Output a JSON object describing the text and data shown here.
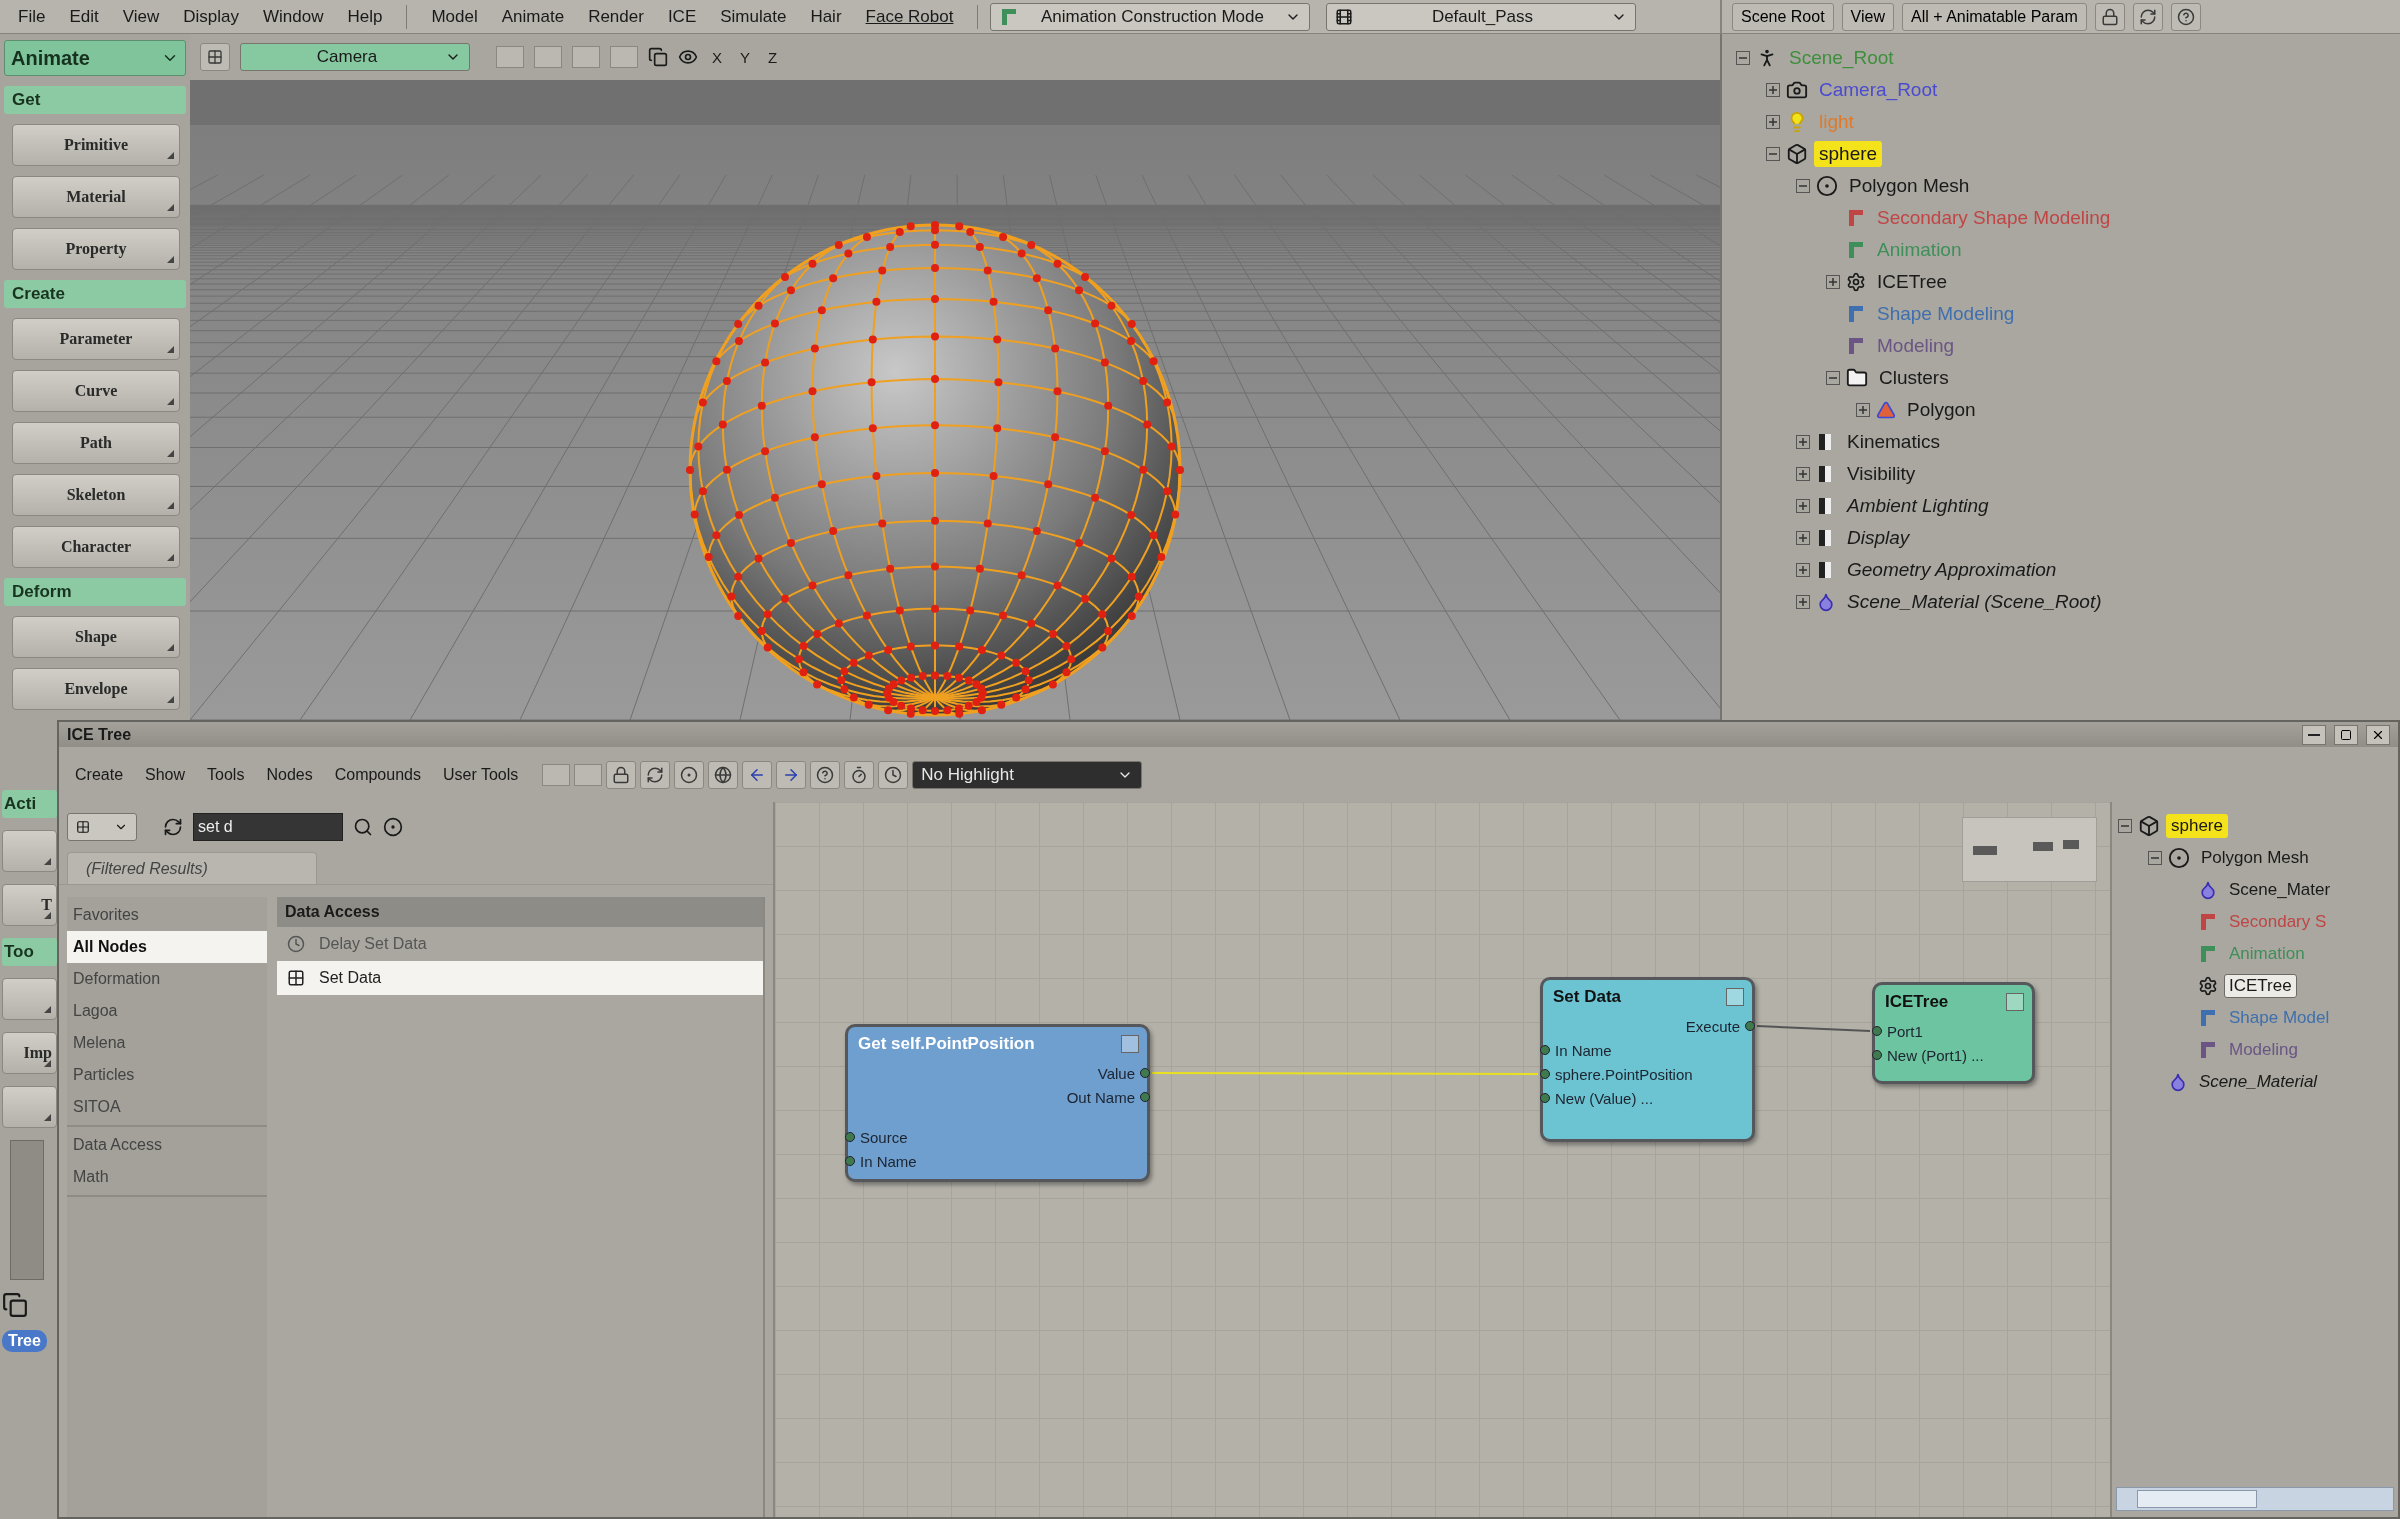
{
  "menu_bar": {
    "menus": [
      {
        "label": "File",
        "kind": "menu"
      },
      {
        "label": "Edit",
        "kind": "menu"
      },
      {
        "label": "View",
        "kind": "menu"
      },
      {
        "label": "Display",
        "kind": "menu"
      },
      {
        "label": "Window",
        "kind": "menu"
      },
      {
        "label": "Help",
        "kind": "menu"
      }
    ],
    "modules": [
      {
        "label": "Model",
        "kind": "menu"
      },
      {
        "label": "Animate",
        "kind": "menu"
      },
      {
        "label": "Render",
        "kind": "menu"
      },
      {
        "label": "ICE",
        "kind": "menu"
      },
      {
        "label": "Simulate",
        "kind": "menu"
      },
      {
        "label": "Hair",
        "kind": "menu"
      },
      {
        "label": "Face Robot",
        "kind": "link"
      }
    ],
    "mode_dropdown": "Animation Construction Mode",
    "pass_dropdown": "Default_Pass"
  },
  "explorer_toolbar": {
    "buttons": [
      "Scene Root",
      "View",
      "All + Animatable Param"
    ]
  },
  "layout_dropdown": "Animate",
  "palette": {
    "sections": [
      {
        "title": "Get",
        "buttons": [
          "Primitive",
          "Material",
          "Property"
        ]
      },
      {
        "title": "Create",
        "buttons": [
          "Parameter",
          "Curve",
          "Path",
          "Skeleton",
          "Character"
        ]
      },
      {
        "title": "Deform",
        "buttons": [
          "Shape",
          "Envelope"
        ]
      }
    ]
  },
  "palette_fragments": [
    {
      "label": "Acti",
      "kind": "header"
    },
    {
      "kind": "button"
    },
    {
      "label": "T",
      "kind": "button"
    },
    {
      "label": "Too",
      "kind": "header"
    },
    {
      "kind": "button"
    },
    {
      "label": "Imp",
      "kind": "button"
    },
    {
      "kind": "button"
    },
    {
      "label": "Tree",
      "kind": "tag"
    }
  ],
  "viewport_toolbar": {
    "camera": "Camera",
    "axes": [
      "X",
      "Y",
      "Z"
    ]
  },
  "scene_tree": [
    {
      "label": "Scene_Root",
      "kind": "null",
      "color": "#3d8f3d",
      "expanded": true,
      "selected": false,
      "children": [
        {
          "label": "Camera_Root",
          "kind": "camera",
          "color": "#4b4bd0",
          "expanded": false,
          "selected": false
        },
        {
          "label": "light",
          "kind": "light",
          "color": "#e07a2a",
          "expanded": false,
          "selected": false
        },
        {
          "label": "sphere",
          "kind": "mesh",
          "expanded": true,
          "selected": true,
          "children": [
            {
              "label": "Polygon Mesh",
              "kind": "geometry",
              "expanded": true,
              "selected": false,
              "children": [
                {
                  "label": "Secondary Shape Modeling",
                  "kind": "operator",
                  "color": "#c04545",
                  "selected": false
                },
                {
                  "label": "Animation",
                  "kind": "operator",
                  "color": "#3f8f5a",
                  "selected": false
                },
                {
                  "label": "ICETree",
                  "kind": "icetree",
                  "expanded": false,
                  "selected": false
                },
                {
                  "label": "Shape Modeling",
                  "kind": "operator",
                  "color": "#3f6fae",
                  "selected": false
                },
                {
                  "label": "Modeling",
                  "kind": "operator",
                  "color": "#6a5585",
                  "selected": false
                },
                {
                  "label": "Clusters",
                  "kind": "cluster",
                  "expanded": true,
                  "selected": false,
                  "children": [
                    {
                      "label": "Polygon",
                      "kind": "polygon",
                      "expanded": false,
                      "selected": false
                    }
                  ]
                }
              ]
            },
            {
              "label": "Kinematics",
              "kind": "property",
              "expanded": false,
              "selected": false
            },
            {
              "label": "Visibility",
              "kind": "property",
              "expanded": false,
              "selected": false
            },
            {
              "label": "Ambient Lighting",
              "kind": "shared",
              "expanded": false,
              "selected": false
            },
            {
              "label": "Display",
              "kind": "shared",
              "expanded": false,
              "selected": false
            },
            {
              "label": "Geometry Approximation",
              "kind": "shared",
              "expanded": false,
              "selected": false
            },
            {
              "label": "Scene_Material (Scene_Root)",
              "kind": "material",
              "expanded": false,
              "selected": false
            }
          ]
        }
      ]
    }
  ],
  "ice_window": {
    "title": "ICE Tree",
    "menus": [
      "Create",
      "Show",
      "Tools",
      "Nodes",
      "Compounds",
      "User Tools"
    ],
    "highlight_dropdown": "No Highlight",
    "search": {
      "value": "set d"
    },
    "filter_tab": "(Filtered Results)",
    "category_groups": [
      {
        "items": [
          {
            "label": "Favorites",
            "selected": false
          },
          {
            "label": "All Nodes",
            "selected": true
          },
          {
            "label": "Deformation",
            "selected": false
          },
          {
            "label": "Lagoa",
            "selected": false
          },
          {
            "label": "Melena",
            "selected": false
          },
          {
            "label": "Particles",
            "selected": false
          },
          {
            "label": "SITOA",
            "selected": false
          }
        ]
      },
      {
        "items": [
          {
            "label": "Data Access",
            "selected": false
          },
          {
            "label": "Math",
            "selected": false
          }
        ]
      }
    ],
    "node_list": {
      "header": "Data Access",
      "items": [
        {
          "label": "Delay Set Data",
          "kind": "delay",
          "selected": false
        },
        {
          "label": "Set Data",
          "kind": "set",
          "selected": true
        }
      ]
    },
    "graph_nodes": [
      {
        "title": "Get self.PointPosition",
        "kind": "get",
        "outputs": [
          "Value",
          "Out Name"
        ],
        "inputs": [
          "Source",
          "In Name"
        ]
      },
      {
        "title": "Set Data",
        "kind": "set",
        "outputs": [
          "Execute"
        ],
        "inputs": [
          "In Name",
          "sphere.PointPosition",
          "New (Value) ..."
        ]
      },
      {
        "title": "ICETree",
        "kind": "root",
        "inputs": [
          "Port1",
          "New (Port1) ..."
        ]
      }
    ],
    "tree": [
      {
        "label": "sphere",
        "kind": "mesh",
        "expanded": true,
        "selected": true,
        "current": false,
        "children": [
          {
            "label": "Polygon Mesh",
            "kind": "geometry",
            "expanded": true,
            "selected": false,
            "current": false,
            "children": [
              {
                "label": "Scene_Mater",
                "kind": "material_plain",
                "selected": false,
                "current": false
              },
              {
                "label": "Secondary S",
                "kind": "operator",
                "color": "#c04545",
                "selected": false,
                "current": false
              },
              {
                "label": "Animation",
                "kind": "operator",
                "color": "#3f8f5a",
                "selected": false,
                "current": false
              },
              {
                "label": "ICETree",
                "kind": "icetree",
                "selected": false,
                "current": true
              },
              {
                "label": "Shape Model",
                "kind": "operator",
                "color": "#3f6fae",
                "selected": false,
                "current": false
              },
              {
                "label": "Modeling",
                "kind": "operator",
                "color": "#6a5585",
                "selected": false,
                "current": false
              }
            ]
          },
          {
            "label": "Scene_Material",
            "kind": "material",
            "selected": false,
            "current": false
          }
        ]
      }
    ]
  }
}
